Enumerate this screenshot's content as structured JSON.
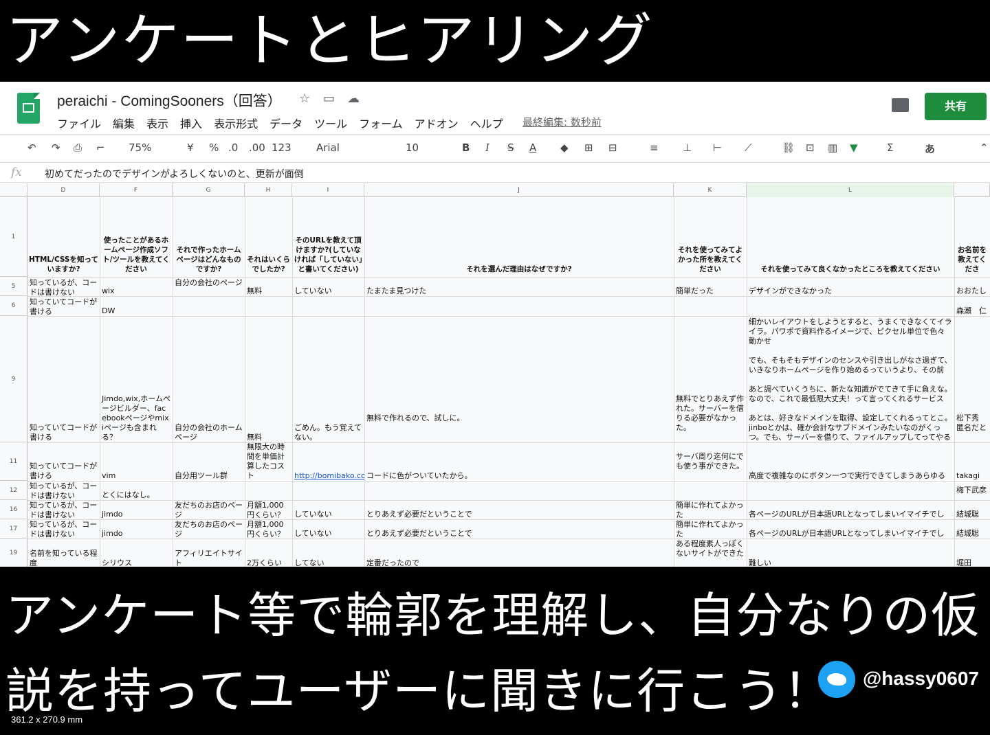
{
  "slide": {
    "title": "アンケートとヒアリング",
    "caption_line1": "アンケート等で輪郭を理解し、自分なりの仮",
    "caption_line2": "説を持ってユーザーに聞きに行こう！",
    "handle": "@hassy0607",
    "dimensions": "361.2 x 270.9 mm"
  },
  "sheets": {
    "doc_title": "peraichi - ComingSooners（回答）",
    "menu": [
      "ファイル",
      "編集",
      "表示",
      "挿入",
      "表示形式",
      "データ",
      "ツール",
      "フォーム",
      "アドオン",
      "ヘルプ"
    ],
    "last_edit": "最終編集: 数秒前",
    "share_label": "共有",
    "toolbar": {
      "zoom": "75%",
      "currency": "¥",
      "percent": "%",
      "dec_less": ".0",
      "dec_more": ".00",
      "format": "123",
      "font": "Arial",
      "size": "10",
      "bold": "B",
      "italic": "I",
      "strike": "S",
      "textcolor": "A",
      "sigma": "Σ",
      "ime": "あ"
    },
    "formula_label": "fx",
    "formula_value": "初めてだったのでデザインがよろしくないのと、更新が面倒",
    "columns": [
      "D",
      "F",
      "G",
      "H",
      "I",
      "J",
      "K",
      "L"
    ],
    "headers": {
      "D": "HTML/CSSを知っていますか?",
      "F": "使ったことがあるホームページ作成ソフト/ツールを教えてください",
      "G": "それで作ったホームページはどんなものですか?",
      "H": "それはいくらでしたか?",
      "I": "そのURLを教えて頂けますか?(していなければ「していない」と書いてください)",
      "J": "それを選んだ理由はなぜですか?",
      "K": "それを使ってみてよかった所を教えてください",
      "L": "それを使ってみて良くなかったところを教えてください",
      "M": "お名前を教えてくださ"
    },
    "rows": [
      {
        "num": "1"
      },
      {
        "num": "5",
        "D": "知っているが、コードは書けない",
        "F": "wix",
        "G": "自分の会社のページ",
        "H": "無料",
        "I": "していない",
        "J": "たまたま見つけた",
        "K": "簡単だった",
        "L": "デザインができなかった",
        "M": "おおたし"
      },
      {
        "num": "6",
        "D": "知っていてコードが書ける",
        "F": "DW",
        "M": "森瀬　仁"
      },
      {
        "num": "9",
        "D": "知っていてコードが書ける",
        "F": "Jimdo,wix,ホームページビルダー、facebookページやmixiページも含まれる？",
        "G": "自分の会社のホームページ",
        "H": "無料",
        "I": "ごめん。もう覚えてない。",
        "J": "無料で作れるので、試しに。",
        "K": "無料でとりあえず作れた。サーバーを借りる必要がなかった。",
        "L": "細かいレイアウトをしようとすると、うまくできなくてイライラ。パワポで資料作るイメージで、ピクセル単位で色々動かせ\n\nでも、そもそもデザインのセンスや引き出しがなさ過ぎて、いきなりホームページを作り始めるっていうより、その前\n\nあと調べていくうちに、新たな知識がでてきて手に負えな。なので、これで最低限大丈夫！って言ってくれるサービス\n\nあとは、好きなドメインを取得、設定してくれるってとこ。jinboとかは、確か会計なサブドメインみたいなのがくっつ。でも、サーバーを借りて、ファイルアップしてってやると。その辺のそもそもの入り口のところも好きなドメインを入のに",
        "M": "松下秀\n匿名だと"
      },
      {
        "num": "11",
        "D": "知っていてコードが書ける",
        "F": "vim",
        "G": "自分用ツール群",
        "H": "無限大の時間を単価計算したコスト",
        "I": "http://bomibako.com",
        "J": "コードに色がついていたから。",
        "K": "サーバ周り迄何にでも使う事ができた。",
        "L": "高度で複雑なのにボタン一つで実行できてしまうあらゆる",
        "M": "takagi"
      },
      {
        "num": "12",
        "D": "知っているが、コードは書けない",
        "F": "とくにはなし。",
        "M": "梅下武彦"
      },
      {
        "num": "16",
        "D": "知っているが、コードは書けない",
        "F": "jimdo",
        "G": "友だちのお店のページ",
        "H": "月額1,000円くらい？",
        "I": "していない",
        "J": "とりあえず必要だということで",
        "K": "簡単に作れてよかった",
        "L": "各ページのURLが日本語URLとなってしまいイマイチでし",
        "M": "結城聡"
      },
      {
        "num": "17",
        "D": "知っているが、コードは書けない",
        "F": "jimdo",
        "G": "友だちのお店のページ",
        "H": "月額1,000円くらい？",
        "I": "していない",
        "J": "とりあえず必要だということで",
        "K": "簡単に作れてよかった",
        "L": "各ページのURLが日本語URLとなってしまいイマイチでし",
        "M": "結城聡"
      },
      {
        "num": "19",
        "D": "名前を知っている程度",
        "F": "シリウス",
        "G": "アフィリエイトサイト",
        "H": "2万くらい",
        "I": "してない",
        "J": "定番だったので",
        "K": "ある程度素人っぽくないサイトができた",
        "L": "難しい",
        "M": "堀田"
      }
    ]
  }
}
